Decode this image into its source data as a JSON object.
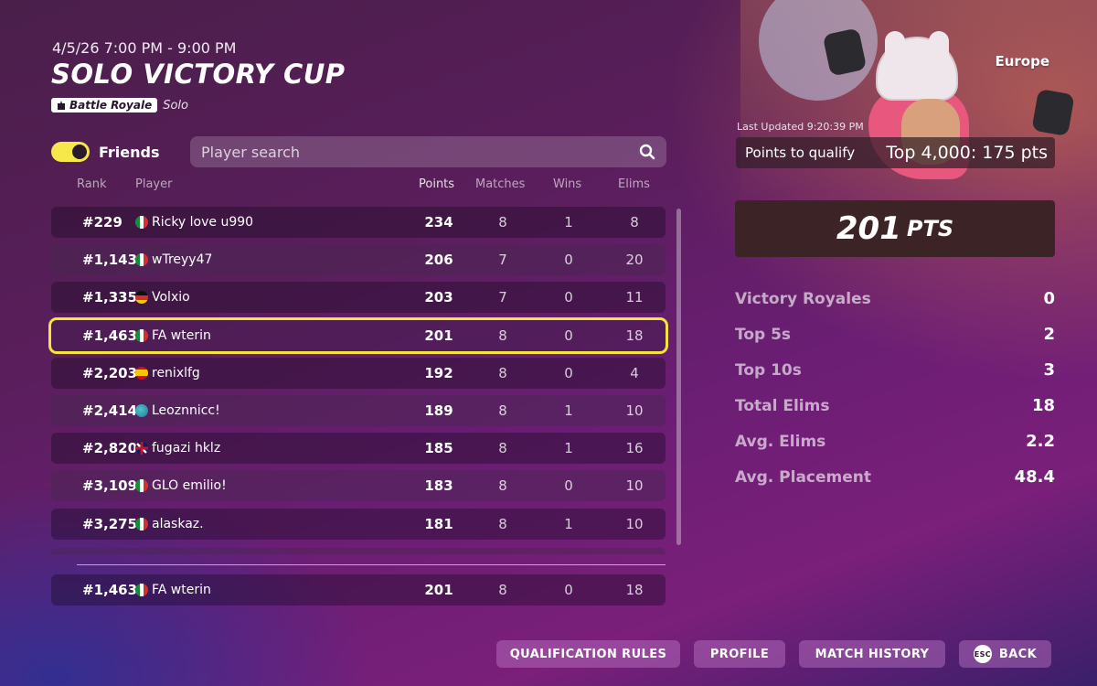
{
  "event": {
    "datetime": "4/5/26 7:00 PM - 9:00 PM",
    "title": "SOLO VICTORY CUP",
    "mode": "Battle Royale",
    "submode": "Solo",
    "region": "Europe"
  },
  "controls": {
    "friends_label": "Friends",
    "friends_on": true,
    "search_placeholder": "Player search"
  },
  "columns": {
    "rank": "Rank",
    "player": "Player",
    "points": "Points",
    "matches": "Matches",
    "wins": "Wins",
    "elims": "Elims"
  },
  "leaderboard": [
    {
      "rank": "#229",
      "flag": "italy",
      "player": "Ricky love u990",
      "points": "234",
      "matches": "8",
      "wins": "1",
      "elims": "8"
    },
    {
      "rank": "#1,143",
      "flag": "italy",
      "player": "wTreyy47",
      "points": "206",
      "matches": "7",
      "wins": "0",
      "elims": "20"
    },
    {
      "rank": "#1,335",
      "flag": "germany",
      "player": "Volxio",
      "points": "203",
      "matches": "7",
      "wins": "0",
      "elims": "11"
    },
    {
      "rank": "#1,463",
      "flag": "italy",
      "player": "FA wterin",
      "points": "201",
      "matches": "8",
      "wins": "0",
      "elims": "18",
      "highlighted": true
    },
    {
      "rank": "#2,203",
      "flag": "spain",
      "player": "renixlfg",
      "points": "192",
      "matches": "8",
      "wins": "0",
      "elims": "4"
    },
    {
      "rank": "#2,414",
      "flag": "globe",
      "player": "Leoznnicc!",
      "points": "189",
      "matches": "8",
      "wins": "1",
      "elims": "10"
    },
    {
      "rank": "#2,820",
      "flag": "uk",
      "player": "fugazi hklz",
      "points": "185",
      "matches": "8",
      "wins": "1",
      "elims": "16"
    },
    {
      "rank": "#3,109",
      "flag": "italy",
      "player": "GLO emilio!",
      "points": "183",
      "matches": "8",
      "wins": "0",
      "elims": "10"
    },
    {
      "rank": "#3,275",
      "flag": "italy",
      "player": "alaskaz.",
      "points": "181",
      "matches": "8",
      "wins": "1",
      "elims": "10"
    }
  ],
  "my_row": {
    "rank": "#1,463",
    "flag": "italy",
    "player": "FA wterin",
    "points": "201",
    "matches": "8",
    "wins": "0",
    "elims": "18"
  },
  "summary": {
    "last_updated": "Last Updated 9:20:39 PM",
    "qualify_label": "Points to qualify",
    "qualify_value": "Top 4,000: 175 pts",
    "points": "201",
    "points_unit": "PTS",
    "stats": [
      {
        "label": "Victory Royales",
        "value": "0"
      },
      {
        "label": "Top 5s",
        "value": "2"
      },
      {
        "label": "Top 10s",
        "value": "3"
      },
      {
        "label": "Total Elims",
        "value": "18"
      },
      {
        "label": "Avg. Elims",
        "value": "2.2"
      },
      {
        "label": "Avg. Placement",
        "value": "48.4"
      }
    ]
  },
  "buttons": {
    "qualification_rules": "QUALIFICATION RULES",
    "profile": "PROFILE",
    "match_history": "MATCH HISTORY",
    "back": "BACK",
    "back_key": "ESC"
  },
  "colors": {
    "highlight": "#f3e53a",
    "toggle_on": "#f6e84a",
    "points_box": "#3b2326"
  },
  "icons": {
    "search": "search-icon",
    "mode": "battle-royale-icon",
    "back_key": "esc-key-icon"
  }
}
